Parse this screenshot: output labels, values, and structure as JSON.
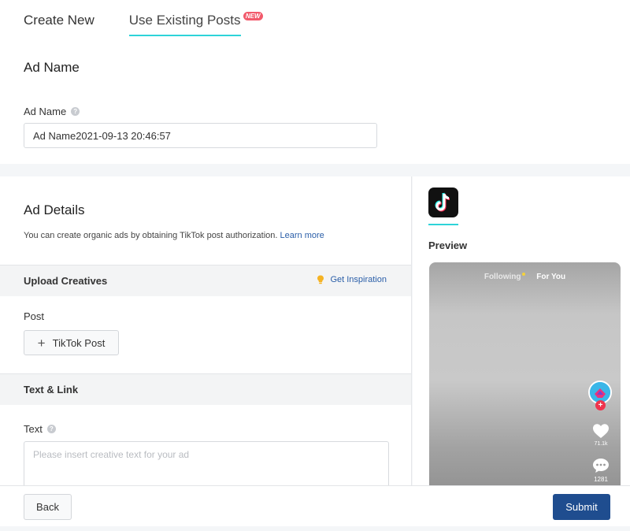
{
  "tabs": {
    "create_new": "Create New",
    "use_existing": "Use Existing Posts",
    "new_badge": "NEW"
  },
  "ad_name_section": {
    "title": "Ad Name",
    "field_label": "Ad Name",
    "value": "Ad Name2021-09-13 20:46:57"
  },
  "ad_details": {
    "title": "Ad Details",
    "description": "You can create organic ads by obtaining TikTok post authorization.",
    "learn_more": "Learn more"
  },
  "upload_creatives": {
    "label": "Upload Creatives",
    "inspiration_link": "Get Inspiration",
    "post_label": "Post",
    "tiktok_post_button": "TikTok Post"
  },
  "text_link": {
    "label": "Text & Link",
    "text_label": "Text",
    "text_placeholder": "Please insert creative text for your ad"
  },
  "preview": {
    "label": "Preview",
    "feed_following": "Following",
    "feed_for_you": "For You",
    "like_count": "71.1k",
    "comment_count": "1281"
  },
  "footer": {
    "back": "Back",
    "submit": "Submit"
  },
  "colors": {
    "accent_underline": "#2ed3d9",
    "submit_bg": "#1f4d8f",
    "link": "#2a5ea8",
    "new_badge": "#f25a6b"
  }
}
